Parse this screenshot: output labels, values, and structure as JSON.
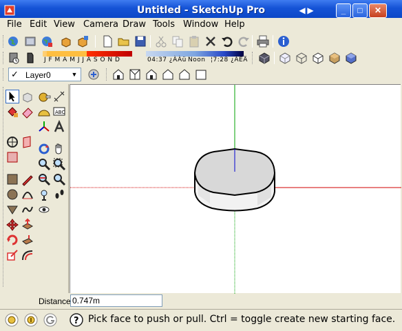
{
  "window": {
    "title": "Untitled - SketchUp Pro"
  },
  "menu": {
    "items": [
      "File",
      "Edit",
      "View",
      "Camera",
      "Draw",
      "Tools",
      "Window",
      "Help"
    ]
  },
  "shadows": {
    "months": "J F M A M J J A S O N D",
    "time_start": "04:37 ¿ÀÀü",
    "time_noon": "Noon",
    "time_end": "¦7:28 ¿ÀÈÄ"
  },
  "layer": {
    "name": "Layer0"
  },
  "measurements": {
    "label": "Distance",
    "value": "0.747m"
  },
  "status": {
    "text": "Pick face to push or pull.  Ctrl = toggle create new starting face."
  },
  "colors": {
    "titlebar": "#1553d6",
    "red_axis": "#d00000",
    "green_axis": "#00a000",
    "blue_axis": "#0000d0",
    "face": "#d8d8d8"
  }
}
